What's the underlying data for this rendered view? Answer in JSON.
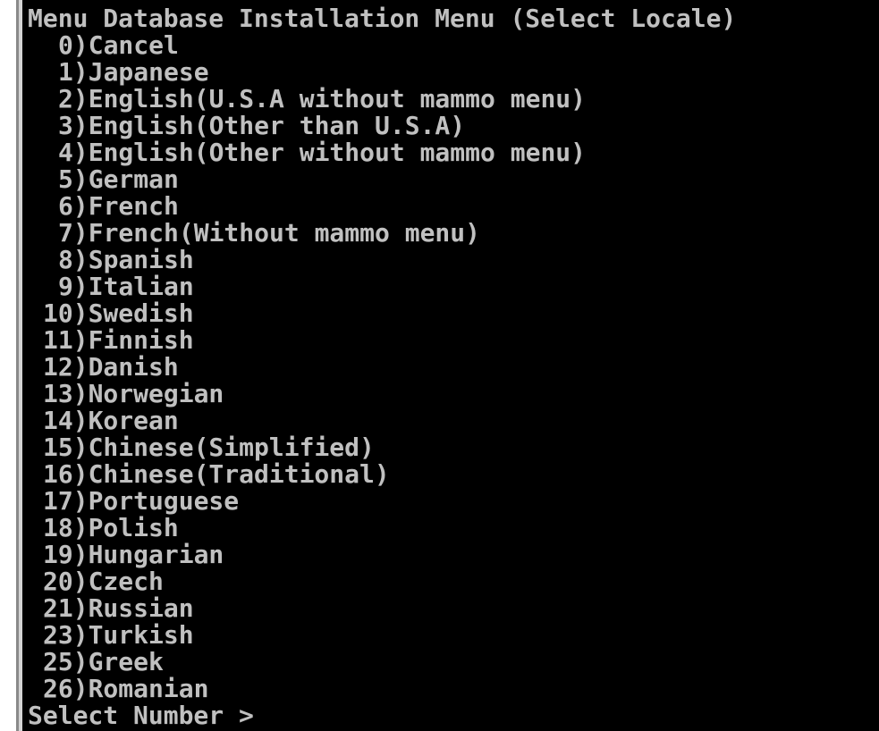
{
  "console": {
    "title": "Menu Database Installation Menu (Select Locale)",
    "options_single": [
      "0)Cancel",
      "1)Japanese",
      "2)English(U.S.A without mammo menu)",
      "3)English(Other than U.S.A)",
      "4)English(Other without mammo menu)",
      "5)German",
      "6)French",
      "7)French(Without mammo menu)",
      "8)Spanish",
      "9)Italian"
    ],
    "options_double": [
      "10)Swedish",
      "11)Finnish",
      "12)Danish",
      "13)Norwegian",
      "14)Korean",
      "15)Chinese(Simplified)",
      "16)Chinese(Traditional)",
      "17)Portuguese",
      "18)Polish",
      "19)Hungarian",
      "20)Czech",
      "21)Russian",
      "23)Turkish",
      "25)Greek",
      "26)Romanian"
    ],
    "prompt": "Select Number >"
  },
  "colors": {
    "background": "#000000",
    "text": "#c0c0c0"
  }
}
